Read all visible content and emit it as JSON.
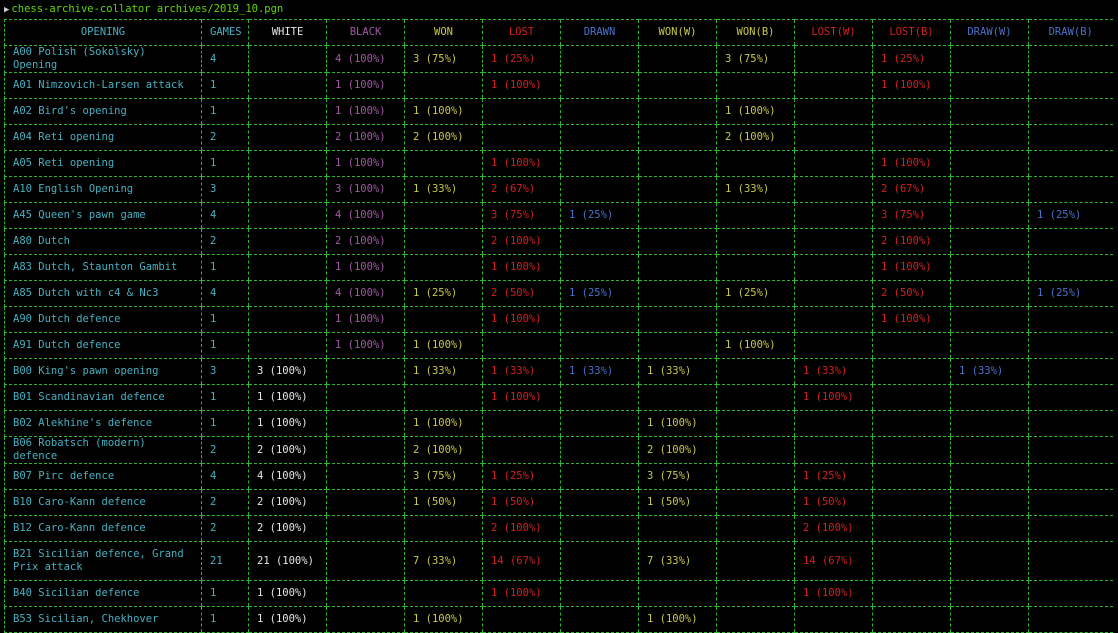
{
  "terminal": {
    "prompt_text": "chess-archive-collator archives/2019_10.pgn"
  },
  "colors": {
    "background": "#000000",
    "border": "#2fb52f",
    "opening": "#46b0c0",
    "white": "#e6e6e6",
    "black": "#a05aa0",
    "won": "#c8c84a",
    "lost": "#d02020",
    "drawn": "#4a70c8"
  },
  "table": {
    "headers": [
      "OPENING",
      "GAMES",
      "WHITE",
      "BLACK",
      "WON",
      "LOST",
      "DRAWN",
      "WON(W)",
      "WON(B)",
      "LOST(W)",
      "LOST(B)",
      "DRAW(W)",
      "DRAW(B)"
    ],
    "rows": [
      [
        "A00 Polish (Sokolsky) Opening",
        "4",
        "",
        "4 (100%)",
        "3 (75%)",
        "1 (25%)",
        "",
        "",
        "3 (75%)",
        "",
        "1 (25%)",
        "",
        ""
      ],
      [
        "A01 Nimzovich-Larsen attack",
        "1",
        "",
        "1 (100%)",
        "",
        "1 (100%)",
        "",
        "",
        "",
        "",
        "1 (100%)",
        "",
        ""
      ],
      [
        "A02 Bird's opening",
        "1",
        "",
        "1 (100%)",
        "1 (100%)",
        "",
        "",
        "",
        "1 (100%)",
        "",
        "",
        "",
        ""
      ],
      [
        "A04 Reti opening",
        "2",
        "",
        "2 (100%)",
        "2 (100%)",
        "",
        "",
        "",
        "2 (100%)",
        "",
        "",
        "",
        ""
      ],
      [
        "A05 Reti opening",
        "1",
        "",
        "1 (100%)",
        "",
        "1 (100%)",
        "",
        "",
        "",
        "",
        "1 (100%)",
        "",
        ""
      ],
      [
        "A10 English Opening",
        "3",
        "",
        "3 (100%)",
        "1 (33%)",
        "2 (67%)",
        "",
        "",
        "1 (33%)",
        "",
        "2 (67%)",
        "",
        ""
      ],
      [
        "A45 Queen's pawn game",
        "4",
        "",
        "4 (100%)",
        "",
        "3 (75%)",
        "1 (25%)",
        "",
        "",
        "",
        "3 (75%)",
        "",
        "1 (25%)"
      ],
      [
        "A80 Dutch",
        "2",
        "",
        "2 (100%)",
        "",
        "2 (100%)",
        "",
        "",
        "",
        "",
        "2 (100%)",
        "",
        ""
      ],
      [
        "A83 Dutch, Staunton Gambit",
        "1",
        "",
        "1 (100%)",
        "",
        "1 (100%)",
        "",
        "",
        "",
        "",
        "1 (100%)",
        "",
        ""
      ],
      [
        "A85 Dutch with c4 & Nc3",
        "4",
        "",
        "4 (100%)",
        "1 (25%)",
        "2 (50%)",
        "1 (25%)",
        "",
        "1 (25%)",
        "",
        "2 (50%)",
        "",
        "1 (25%)"
      ],
      [
        "A90 Dutch defence",
        "1",
        "",
        "1 (100%)",
        "",
        "1 (100%)",
        "",
        "",
        "",
        "",
        "1 (100%)",
        "",
        ""
      ],
      [
        "A91 Dutch defence",
        "1",
        "",
        "1 (100%)",
        "1 (100%)",
        "",
        "",
        "",
        "1 (100%)",
        "",
        "",
        "",
        ""
      ],
      [
        "B00 King's pawn opening",
        "3",
        "3 (100%)",
        "",
        "1 (33%)",
        "1 (33%)",
        "1 (33%)",
        "1 (33%)",
        "",
        "1 (33%)",
        "",
        "1 (33%)",
        ""
      ],
      [
        "B01 Scandinavian defence",
        "1",
        "1 (100%)",
        "",
        "",
        "1 (100%)",
        "",
        "",
        "",
        "1 (100%)",
        "",
        "",
        ""
      ],
      [
        "B02 Alekhine's defence",
        "1",
        "1 (100%)",
        "",
        "1 (100%)",
        "",
        "",
        "1 (100%)",
        "",
        "",
        "",
        "",
        ""
      ],
      [
        "B06 Robatsch (modern) defence",
        "2",
        "2 (100%)",
        "",
        "2 (100%)",
        "",
        "",
        "2 (100%)",
        "",
        "",
        "",
        "",
        ""
      ],
      [
        "B07 Pirc defence",
        "4",
        "4 (100%)",
        "",
        "3 (75%)",
        "1 (25%)",
        "",
        "3 (75%)",
        "",
        "1 (25%)",
        "",
        "",
        ""
      ],
      [
        "B10 Caro-Kann defence",
        "2",
        "2 (100%)",
        "",
        "1 (50%)",
        "1 (50%)",
        "",
        "1 (50%)",
        "",
        "1 (50%)",
        "",
        "",
        ""
      ],
      [
        "B12 Caro-Kann defence",
        "2",
        "2 (100%)",
        "",
        "",
        "2 (100%)",
        "",
        "",
        "",
        "2 (100%)",
        "",
        "",
        ""
      ],
      [
        "B21 Sicilian defence, Grand Prix attack",
        "21",
        "21 (100%)",
        "",
        "7 (33%)",
        "14 (67%)",
        "",
        "7 (33%)",
        "",
        "14 (67%)",
        "",
        "",
        ""
      ],
      [
        "B40 Sicilian defence",
        "1",
        "1 (100%)",
        "",
        "",
        "1 (100%)",
        "",
        "",
        "",
        "1 (100%)",
        "",
        "",
        ""
      ],
      [
        "B53 Sicilian, Chekhover",
        "1",
        "1 (100%)",
        "",
        "1 (100%)",
        "",
        "",
        "1 (100%)",
        "",
        "",
        "",
        "",
        ""
      ]
    ]
  }
}
